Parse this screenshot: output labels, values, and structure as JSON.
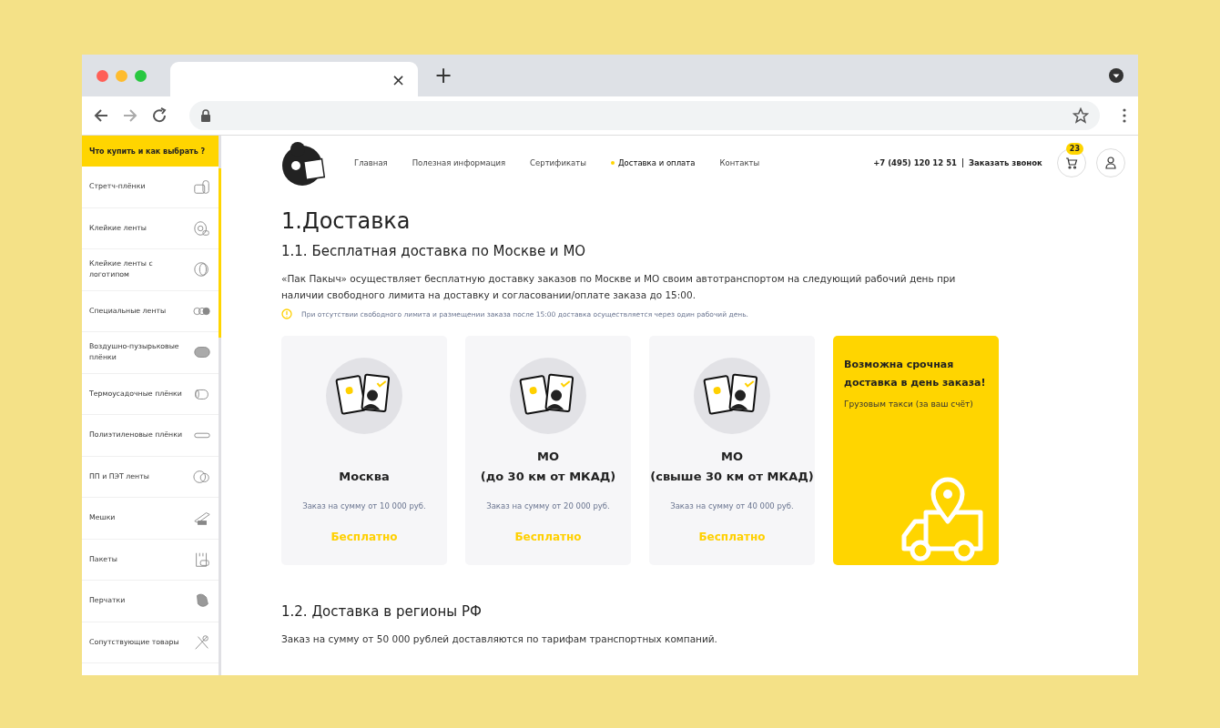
{
  "browser": {
    "tab_close": "×",
    "new_tab": "+"
  },
  "sidebar": {
    "title": "Что купить и как выбрать ?",
    "items": [
      {
        "label": "Стретч-плёнки"
      },
      {
        "label": "Клейкие ленты"
      },
      {
        "label": "Клейкие ленты с логотипом"
      },
      {
        "label": "Специальные ленты"
      },
      {
        "label": "Воздушно-пузырьковые плёнки"
      },
      {
        "label": "Термоусадочные плёнки"
      },
      {
        "label": "Полиэтиленовые плёнки"
      },
      {
        "label": "ПП и ПЭТ ленты"
      },
      {
        "label": "Мешки"
      },
      {
        "label": "Пакеты"
      },
      {
        "label": "Перчатки"
      },
      {
        "label": "Сопутствующие товары"
      }
    ]
  },
  "nav": [
    {
      "label": "Главная",
      "selected": false
    },
    {
      "label": "Полезная информация",
      "selected": false
    },
    {
      "label": "Сертификаты",
      "selected": false
    },
    {
      "label": "Доставка и оплата",
      "selected": true
    },
    {
      "label": "Контакты",
      "selected": false
    }
  ],
  "phone": "+7 (495) 120 12 51",
  "callback": "Заказать звонок",
  "cart_count": "23",
  "heading": "1.Доставка",
  "section1": {
    "title": "1.1. Бесплатная доставка по Москве и МО",
    "text": "«Пак Пакыч» осуществляет бесплатную доставку заказов по Москве и МО своим автотранспортом на следующий рабочий день при наличии свободного лимита на доставку и согласовании/оплате заказа до 15:00.",
    "note": "При отсутствии свободного лимита и размещении заказа после 15:00 доставка осуществляется через один рабочий день."
  },
  "cards": [
    {
      "kind": "zone",
      "title": [
        "Москва"
      ],
      "condition": "Заказ на сумму от 10 000 руб.",
      "price": "Бесплатно"
    },
    {
      "kind": "zone",
      "title": [
        "МО",
        "(до 30 км от МКАД)"
      ],
      "condition": "Заказ на сумму от 20 000 руб.",
      "price": "Бесплатно"
    },
    {
      "kind": "zone",
      "title": [
        "МО",
        "(свыше 30 км от МКАД)"
      ],
      "condition": "Заказ на сумму от 40 000 руб.",
      "price": "Бесплатно"
    },
    {
      "kind": "express",
      "title": [
        "Возможна срочная доставка в день заказа!"
      ],
      "condition": "Грузовым такси (за ваш счёт)"
    }
  ],
  "section2": {
    "title": "1.2. Доставка в регионы РФ",
    "text": "Заказ на сумму от 50 000 рублей доставляются по тарифам транспортных компаний."
  }
}
